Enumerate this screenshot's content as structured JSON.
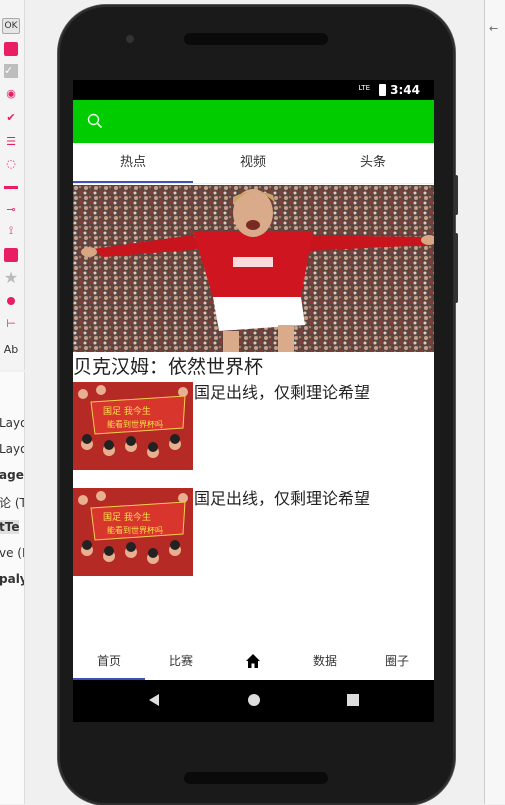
{
  "ide": {
    "palette_ok": "OK",
    "palette_ab": "Ab",
    "left_items": [
      "Layo",
      "Layo",
      "age",
      "论 (T",
      "tTe",
      "ve (E",
      "palyi"
    ]
  },
  "status": {
    "lte": "LTE",
    "time": "3:44"
  },
  "toolbar": {
    "color": "#00cc00",
    "search_icon": "search-icon"
  },
  "top_tabs": [
    {
      "label": "热点",
      "active": true
    },
    {
      "label": "视频",
      "active": false
    },
    {
      "label": "头条",
      "active": false
    }
  ],
  "hero": {
    "title": "贝克汉姆：依然世界杯"
  },
  "news": [
    {
      "title": "国足出线，仅剩理论希望",
      "banner_text": "国足 我今生 能看到世界杯吗"
    },
    {
      "title": "国足出线，仅剩理论希望",
      "banner_text": "国足 我今生 能看到世界杯吗"
    }
  ],
  "bottom_nav": [
    {
      "label": "首页",
      "active": true
    },
    {
      "label": "比赛",
      "active": false
    },
    {
      "label": "",
      "icon": "home-icon",
      "active": false
    },
    {
      "label": "数据",
      "active": false
    },
    {
      "label": "圈子",
      "active": false
    }
  ],
  "accent_color": "#3f51b5"
}
